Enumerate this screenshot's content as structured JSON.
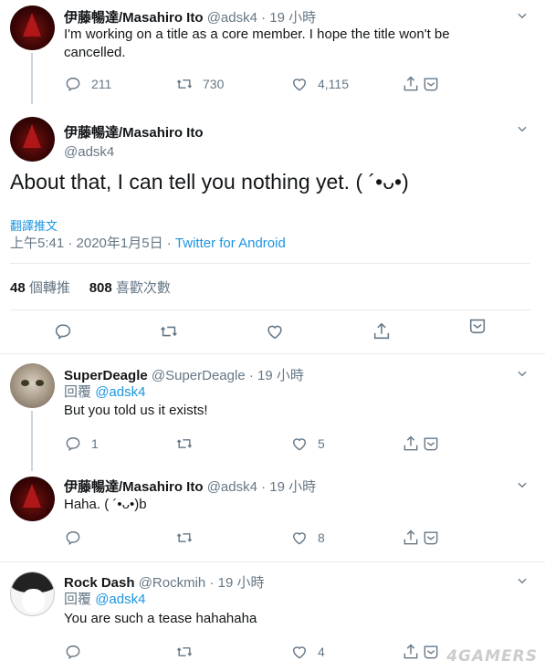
{
  "tweets": [
    {
      "name": "伊藤暢達/Masahiro Ito",
      "handle": "@adsk4",
      "time": "· 19 小時",
      "text": "I'm working on a title as a core member. I hope the title won't be cancelled.",
      "replies": "211",
      "retweets": "730",
      "likes": "4,115"
    },
    {
      "name": "伊藤暢達/Masahiro Ito",
      "handle": "@adsk4",
      "text": "About that, I can tell you nothing yet. ( ´•ᴗ•)",
      "translate": "翻譯推文",
      "timestamp": "上午5:41 · 2020年1月5日 · ",
      "client": "Twitter for Android",
      "retweet_count": "48",
      "retweet_label": "個轉推",
      "like_count": "808",
      "like_label": "喜歡次數"
    },
    {
      "name": "SuperDeagle",
      "handle": "@SuperDeagle",
      "time": "· 19 小時",
      "reply_prefix": "回覆",
      "reply_to": "@adsk4",
      "text": "But you told us it exists!",
      "replies": "1",
      "retweets": "",
      "likes": "5"
    },
    {
      "name": "伊藤暢達/Masahiro Ito",
      "handle": "@adsk4",
      "time": "· 19 小時",
      "text": "Haha. ( ´•ᴗ•)b",
      "replies": "",
      "retweets": "",
      "likes": "8"
    },
    {
      "name": "Rock Dash",
      "handle": "@Rockmih",
      "time": "· 19 小時",
      "reply_prefix": "回覆",
      "reply_to": "@adsk4",
      "text": "You are such a tease hahahaha",
      "replies": "",
      "retweets": "",
      "likes": "4"
    }
  ],
  "watermark": "4GAMERS",
  "colors": {
    "link": "#1b95e0",
    "muted": "#657786",
    "text": "#14171a",
    "separator": "#e6ecf0"
  }
}
